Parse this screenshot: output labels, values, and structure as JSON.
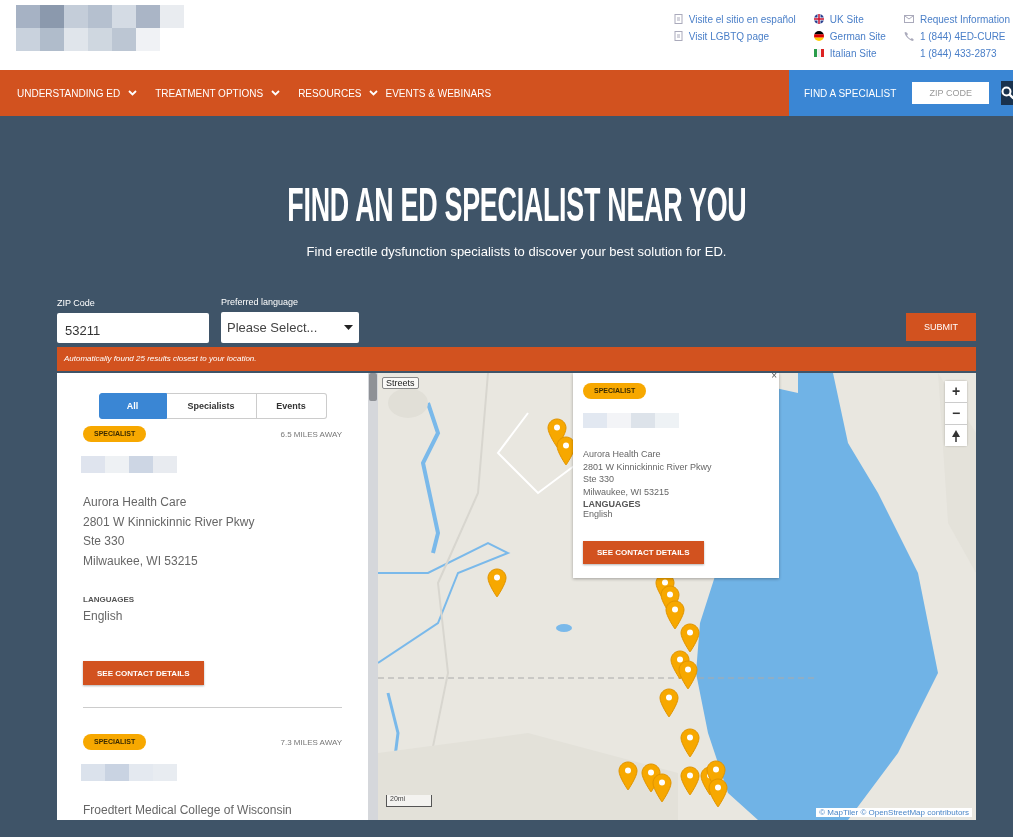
{
  "header": {
    "links": [
      "Visite el sitio en español",
      "Visit LGBTQ page"
    ],
    "sites": [
      "UK Site",
      "German Site",
      "Italian Site"
    ],
    "contact": [
      "Request Information",
      "1 (844) 4ED-CURE",
      "1 (844) 433-2873"
    ]
  },
  "nav": {
    "items": [
      {
        "label": "UNDERSTANDING ED",
        "dropdown": true
      },
      {
        "label": "TREATMENT OPTIONS",
        "dropdown": true
      },
      {
        "label": "RESOURCES",
        "dropdown": true
      },
      {
        "label": "EVENTS & WEBINARS",
        "dropdown": false
      }
    ],
    "find_label": "FIND A SPECIALIST",
    "zip_placeholder": "ZIP CODE"
  },
  "hero": {
    "title": "FIND AN ED SPECIALIST NEAR YOU",
    "subtitle": "Find erectile dysfunction specialists to discover your best solution for ED."
  },
  "form": {
    "zip_label": "ZIP Code",
    "zip_value": "53211",
    "language_label": "Preferred language",
    "language_value": "Please Select...",
    "submit": "SUBMIT"
  },
  "notice": "Automatically found 25 results closest to your location.",
  "filter_tabs": [
    {
      "label": "All",
      "selected": true
    },
    {
      "label": "Specialists",
      "selected": false
    },
    {
      "label": "Events",
      "selected": false
    }
  ],
  "results": [
    {
      "tag": "SPECIALIST",
      "distance": "6.5 MILES AWAY",
      "address": [
        "Aurora Health Care",
        "2801 W Kinnickinnic River Pkwy",
        "Ste 330",
        "Milwaukee, WI 53215"
      ],
      "languages_label": "LANGUAGES",
      "languages": "English",
      "button": "SEE CONTACT DETAILS"
    },
    {
      "tag": "SPECIALIST",
      "distance": "7.3 MILES AWAY",
      "address": [
        "Froedtert Medical College of Wisconsin"
      ]
    }
  ],
  "map": {
    "layer_label": "Streets",
    "zoom_in": "+",
    "zoom_out": "−",
    "scale": "20mi",
    "attribution": "© MapTiler © OpenStreetMap contributors",
    "popup": {
      "close": "×",
      "tag": "SPECIALIST",
      "address": [
        "Aurora Health Care",
        "2801 W Kinnickinnic River Pkwy",
        "Ste 330",
        "Milwaukee, WI 53215"
      ],
      "languages_label": "LANGUAGES",
      "languages": "English",
      "button": "SEE CONTACT DETAILS"
    }
  }
}
